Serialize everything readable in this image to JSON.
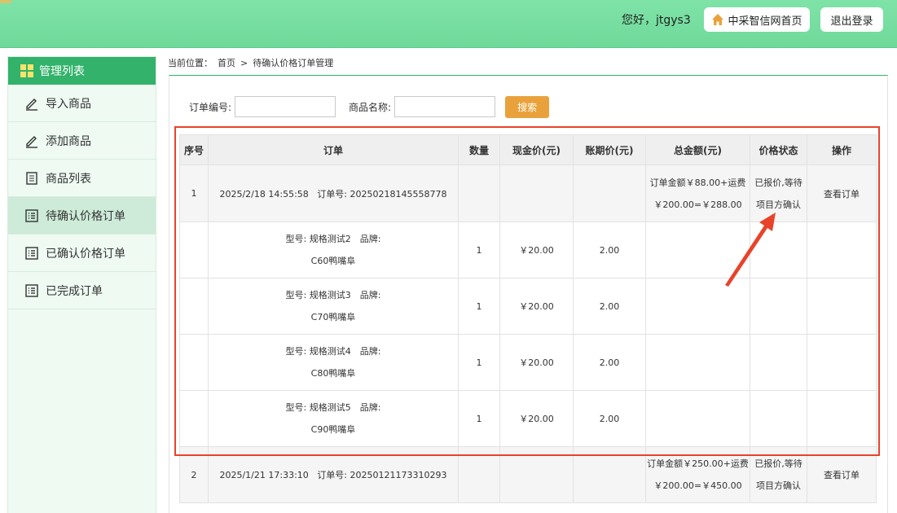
{
  "header": {
    "greeting": "您好，jtgys3",
    "home_label": "中采智信网首页",
    "logout_label": "退出登录"
  },
  "sidebar": {
    "title": "管理列表",
    "items": [
      {
        "label": "导入商品",
        "icon": "pencil-icon"
      },
      {
        "label": "添加商品",
        "icon": "pencil-icon"
      },
      {
        "label": "商品列表",
        "icon": "document-icon"
      },
      {
        "label": "待确认价格订单",
        "icon": "list-icon",
        "active": true
      },
      {
        "label": "已确认价格订单",
        "icon": "list-icon"
      },
      {
        "label": "已完成订单",
        "icon": "list-icon"
      }
    ]
  },
  "breadcrumb": {
    "prefix": "当前位置：",
    "home": "首页",
    "separator": ">",
    "current": "待确认价格订单管理"
  },
  "filters": {
    "order_no_label": "订单编号:",
    "order_no_value": "",
    "product_name_label": "商品名称:",
    "product_name_value": "",
    "search_label": "搜索"
  },
  "table": {
    "headers": [
      "序号",
      "订单",
      "数量",
      "现金价(元)",
      "账期价(元)",
      "总金额(元)",
      "价格状态",
      "操作"
    ],
    "orders": [
      {
        "index": "1",
        "date": "2025/2/18 14:55:58",
        "order_no_label": "订单号:",
        "order_no": "20250218145558778",
        "total_line1": "订单金额￥88.00+运费",
        "total_line2": "￥200.00=￥288.00",
        "status_line1": "已报价,等待",
        "status_line2": "项目方确认",
        "action": "查看订单",
        "items": [
          {
            "spec_line1": "型号: 规格测试2　品牌:",
            "spec_line2": "C60鸭嘴阜",
            "qty": "1",
            "cash": "￥20.00",
            "credit": "2.00"
          },
          {
            "spec_line1": "型号: 规格测试3　品牌:",
            "spec_line2": "C70鸭嘴阜",
            "qty": "1",
            "cash": "￥20.00",
            "credit": "2.00"
          },
          {
            "spec_line1": "型号: 规格测试4　品牌:",
            "spec_line2": "C80鸭嘴阜",
            "qty": "1",
            "cash": "￥20.00",
            "credit": "2.00"
          },
          {
            "spec_line1": "型号: 规格测试5　品牌:",
            "spec_line2": "C90鸭嘴阜",
            "qty": "1",
            "cash": "￥20.00",
            "credit": "2.00"
          }
        ]
      },
      {
        "index": "2",
        "date": "2025/1/21 17:33:10",
        "order_no_label": "订单号:",
        "order_no": "20250121173310293",
        "total_line1": "订单金额￥250.00+运费",
        "total_line2": "￥200.00=￥450.00",
        "status_line1": "已报价,等待",
        "status_line2": "项目方确认",
        "action": "查看订单",
        "items": []
      }
    ]
  },
  "colors": {
    "header_green": "#7fe3a7",
    "accent_green": "#32b26a",
    "search_orange": "#e9a23b",
    "annotation_red": "#e8432a"
  }
}
